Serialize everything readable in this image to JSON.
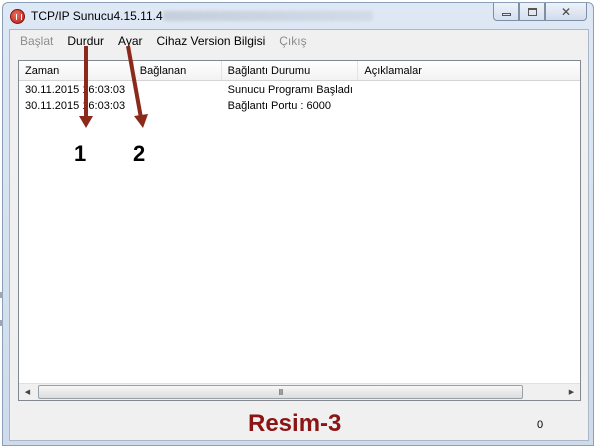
{
  "window": {
    "title": "TCP/IP Sunucu4.15.11.4"
  },
  "menu": {
    "items": [
      {
        "label": "Başlat",
        "enabled": false
      },
      {
        "label": "Durdur",
        "enabled": true
      },
      {
        "label": "Ayar",
        "enabled": true
      },
      {
        "label": "Cihaz Version Bilgisi",
        "enabled": true
      },
      {
        "label": "Çıkış",
        "enabled": false
      }
    ]
  },
  "table": {
    "columns": [
      "Zaman",
      "Bağlanan",
      "Bağlantı Durumu",
      "Açıklamalar"
    ],
    "rows": [
      [
        "30.11.2015 16:03:03",
        "",
        "Sunucu Programı Başladı",
        ""
      ],
      [
        "30.11.2015 16:03:03",
        "",
        "Bağlantı Portu : 6000",
        ""
      ]
    ]
  },
  "scrollbar": {
    "left_icon": "arrow-left-icon",
    "right_icon": "arrow-right-icon",
    "grip": "III"
  },
  "status": {
    "caption": "Resim-3",
    "count": "0"
  },
  "annotations": {
    "arrow1_label": "1",
    "arrow2_label": "2"
  },
  "colors": {
    "caption": "#8b1414",
    "arrow": "#8b2a1a",
    "disabled_menu": "#8d8d8d"
  }
}
